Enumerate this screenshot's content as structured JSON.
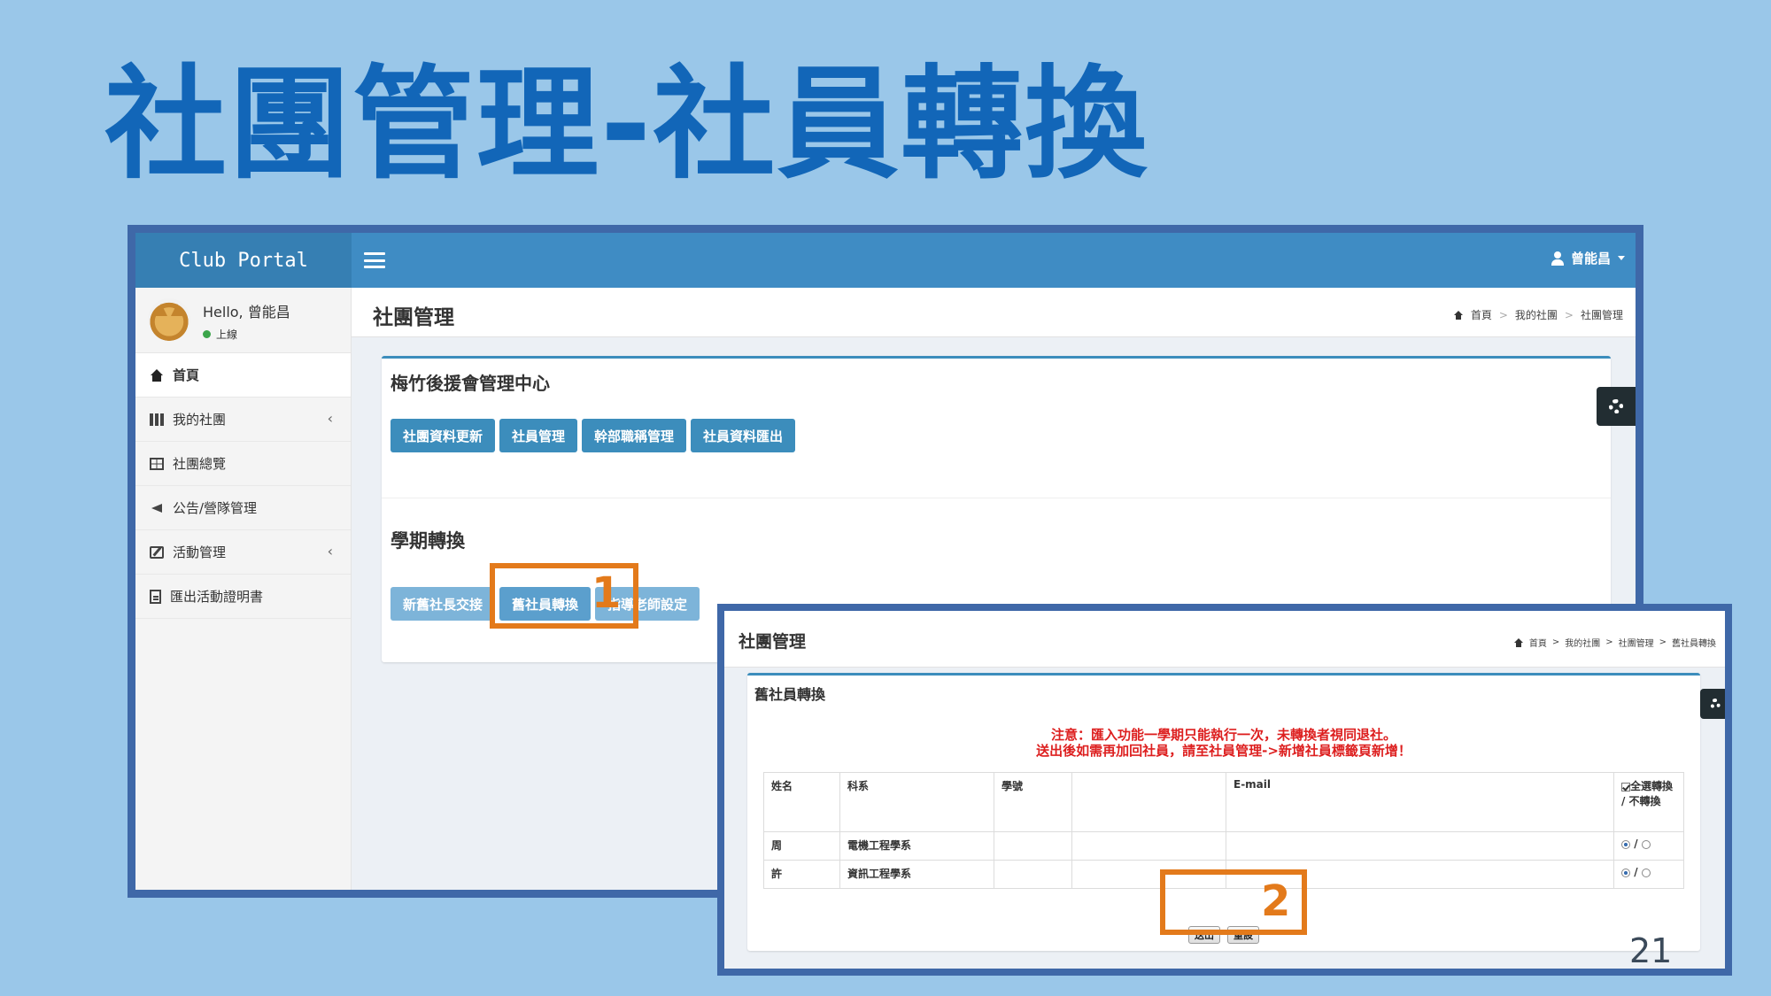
{
  "slide": {
    "title": "社團管理-社員轉換",
    "page_number": "21"
  },
  "colors": {
    "slide_background": "#9ac7e9",
    "title": "#1266b8",
    "topbar": "#3f8cc4",
    "primary_button": "#3c8dbc",
    "highlight": "#e37a1b",
    "notice_red": "#dd1f1f"
  },
  "shot1": {
    "brand": "Club Portal",
    "user_menu": "曾能昌",
    "hello": "Hello, 曾能昌",
    "status": "上線",
    "sidebar": [
      {
        "label": "首頁",
        "icon": "home-icon"
      },
      {
        "label": "我的社團",
        "icon": "grid-icon",
        "has_chevron": true
      },
      {
        "label": "社團總覽",
        "icon": "table-icon"
      },
      {
        "label": "公告/營隊管理",
        "icon": "bullhorn-icon"
      },
      {
        "label": "活動管理",
        "icon": "edit-icon",
        "has_chevron": true
      },
      {
        "label": "匯出活動證明書",
        "icon": "document-icon"
      }
    ],
    "chevron": "‹",
    "page_title": "社團管理",
    "breadcrumb": [
      "首頁",
      "我的社團",
      "社團管理"
    ],
    "breadcrumb_sep": ">",
    "box_title": "梅竹後援會管理中心",
    "buttons": [
      "社團資料更新",
      "社員管理",
      "幹部職稱管理",
      "社員資料匯出"
    ],
    "section_title": "學期轉換",
    "semester_buttons": [
      "新舊社長交接",
      "舊社員轉換",
      "指導老師設定"
    ],
    "callout_number": "1"
  },
  "shot2": {
    "page_title": "社團管理",
    "breadcrumb": [
      "首頁",
      "我的社團",
      "社團管理",
      "舊社員轉換"
    ],
    "breadcrumb_sep": ">",
    "box_title": "舊社員轉換",
    "notice_line1": "注意：匯入功能一學期只能執行一次，未轉換者視同退社。",
    "notice_line2": "送出後如需再加回社員，請至社員管理->新增社員標籤頁新增！",
    "table": {
      "headers": [
        "姓名",
        "科系",
        "學號",
        "",
        "E-mail",
        "全選轉換 / 不轉換"
      ],
      "rows": [
        {
          "name": "周",
          "dept": "電機工程學系",
          "id": "",
          "blank": "",
          "email": "",
          "slash": "/"
        },
        {
          "name": "許",
          "dept": "資訊工程學系",
          "id": "",
          "blank": "",
          "email": "",
          "slash": "/"
        }
      ]
    },
    "submit_label": "送出",
    "reset_label": "重設",
    "callout_number": "2"
  }
}
